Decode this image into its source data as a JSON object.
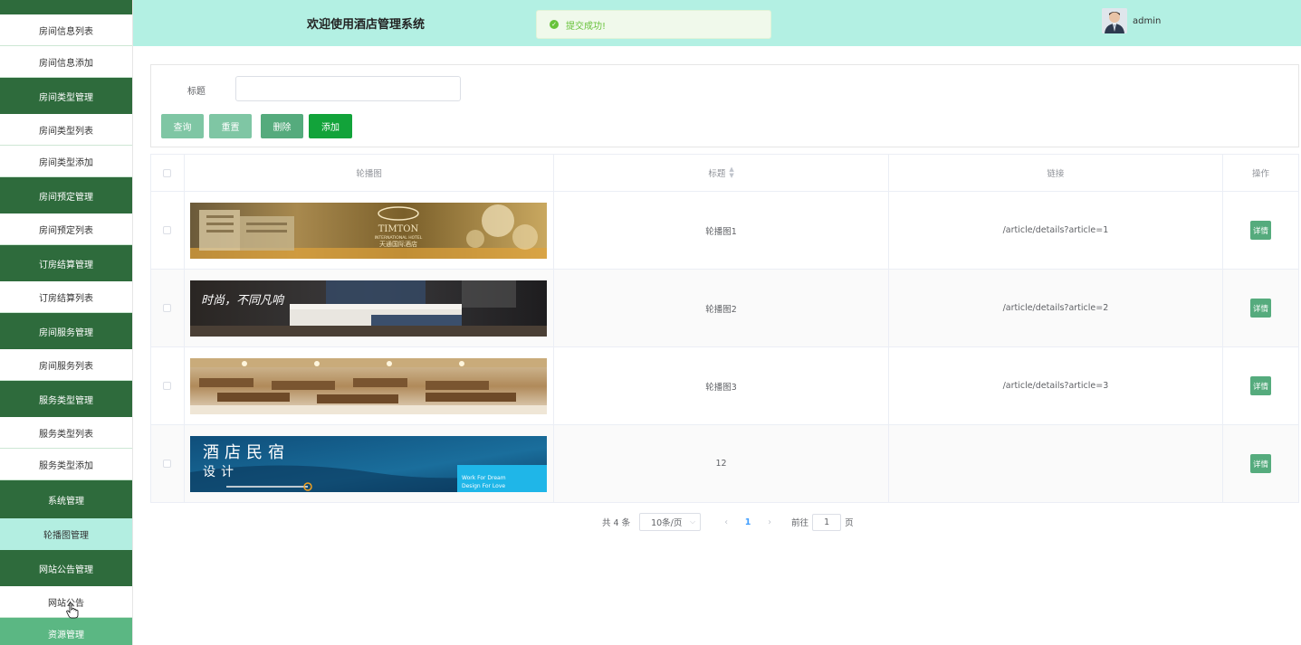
{
  "sidebar": {
    "items": [
      {
        "label": "房间信息列表",
        "type": "sub"
      },
      {
        "label": "房间信息添加",
        "type": "sub"
      },
      {
        "label": "房间类型管理",
        "type": "group"
      },
      {
        "label": "房间类型列表",
        "type": "sub"
      },
      {
        "label": "房间类型添加",
        "type": "sub"
      },
      {
        "label": "房间预定管理",
        "type": "group"
      },
      {
        "label": "房间预定列表",
        "type": "sub"
      },
      {
        "label": "订房结算管理",
        "type": "group"
      },
      {
        "label": "订房结算列表",
        "type": "sub"
      },
      {
        "label": "房间服务管理",
        "type": "group"
      },
      {
        "label": "房间服务列表",
        "type": "sub"
      },
      {
        "label": "服务类型管理",
        "type": "group"
      },
      {
        "label": "服务类型列表",
        "type": "sub"
      },
      {
        "label": "服务类型添加",
        "type": "sub"
      },
      {
        "label": "系统管理",
        "type": "group"
      },
      {
        "label": "轮播图管理",
        "type": "active"
      },
      {
        "label": "网站公告管理",
        "type": "group"
      },
      {
        "label": "网站公告",
        "type": "sub"
      },
      {
        "label": "资源管理",
        "type": "lightgroup"
      }
    ]
  },
  "header": {
    "title": "欢迎使用酒店管理系统",
    "toast": "提交成功!",
    "user": "admin"
  },
  "search": {
    "label": "标题",
    "value": "",
    "placeholder": "",
    "buttons": {
      "query": "查询",
      "reset": "重置",
      "delete": "删除",
      "add": "添加"
    }
  },
  "table": {
    "columns": {
      "image": "轮播图",
      "title": "标题",
      "link": "链接",
      "op": "操作"
    },
    "rows": [
      {
        "title": "轮播图1",
        "link": "/article/details?article=1",
        "action": "详情",
        "banner_text": "TIMTON",
        "banner_sub": "INTERNATIONAL HOTEL",
        "banner_cn": "天通国际酒店"
      },
      {
        "title": "轮播图2",
        "link": "/article/details?article=2",
        "action": "详情",
        "banner_text": "时尚，不同凡响"
      },
      {
        "title": "轮播图3",
        "link": "/article/details?article=3",
        "action": "详情"
      },
      {
        "title": "12",
        "link": "",
        "action": "详情",
        "banner_text": "酒店民宿",
        "banner_sub": "设计",
        "banner_en1": "Work For Dream",
        "banner_en2": "Design For Love"
      }
    ]
  },
  "pager": {
    "total": "共 4 条",
    "size": "10条/页",
    "prev": "‹",
    "page": "1",
    "next": "›",
    "goto": "前往",
    "goto_value": "1",
    "page_suffix": "页"
  },
  "colors": {
    "sidebar_group": "#2e6b3c",
    "sidebar_active": "#b3eee1",
    "header_bg": "#b3f0e3",
    "button_green": "#55ab7d",
    "add_button": "#12a33a"
  }
}
